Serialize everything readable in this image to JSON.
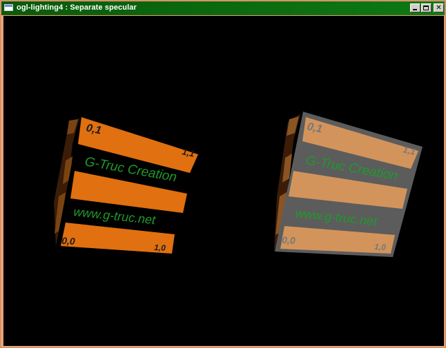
{
  "window": {
    "title": "ogl-lighting4 : Separate specular",
    "close_glyph": "✕"
  },
  "icons": {
    "app": "window-app-icon",
    "minimize": "minimize-icon",
    "maximize": "maximize-icon",
    "close": "close-icon"
  },
  "cubes": [
    {
      "corner_top_left": "0,1",
      "corner_top_right": "1,1",
      "corner_bottom_left": "0,0",
      "corner_bottom_right": "1,0",
      "headline": "G-Truc Creation",
      "url": "www.g-truc.net",
      "stripe_color": "#e07010",
      "band_color": "#000000"
    },
    {
      "corner_top_left": "0,1",
      "corner_top_right": "1,1",
      "corner_bottom_left": "0,0",
      "corner_bottom_right": "1,0",
      "headline": "G-Truc Creation",
      "url": "www.g-truc.net",
      "stripe_color": "#d3945c",
      "band_color": "#5a5a5a"
    }
  ],
  "colors": {
    "title_bar": "#0b6b10",
    "frame": "#e9a276",
    "text_green": "#1f9a2a",
    "label_dark": "#1a1a1a"
  }
}
